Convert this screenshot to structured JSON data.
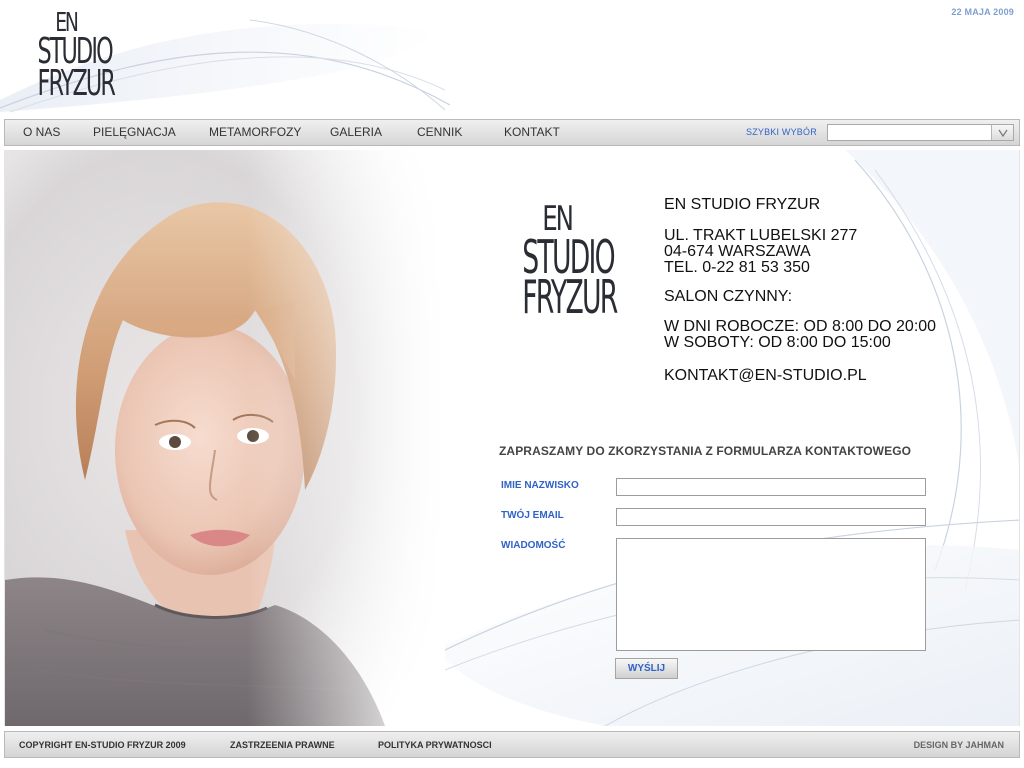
{
  "header": {
    "logo": {
      "line1": "EN",
      "line2": "STUDIO",
      "line3": "FRYZUR"
    },
    "date": "22 MAJA 2009"
  },
  "nav": {
    "items": [
      {
        "label": "O NAS"
      },
      {
        "label": "PIELĘGNACJA"
      },
      {
        "label": "METAMORFOZY"
      },
      {
        "label": "GALERIA"
      },
      {
        "label": "CENNIK"
      },
      {
        "label": "KONTAKT"
      }
    ],
    "quick_select": {
      "label": "SZYBKI WYBÓR",
      "value": "",
      "arrow_icon": "chevron-down-icon"
    }
  },
  "contact": {
    "logo": {
      "line1": "EN",
      "line2": "STUDIO",
      "line3": "FRYZUR"
    },
    "salon_name": "EN STUDIO FRYZUR",
    "address_line1": "UL. TRAKT LUBELSKI 277",
    "address_line2": "04-674 WARSZAWA",
    "phone": "TEL. 0-22 81 53 350",
    "hours_heading": "SALON CZYNNY:",
    "hours_weekdays": "W DNI ROBOCZE: OD 8:00 DO 20:00",
    "hours_saturday": "W SOBOTY: OD 8:00 DO 15:00",
    "email": "KONTAKT@EN-STUDIO.PL"
  },
  "form": {
    "title": "ZAPRASZAMY DO ZKORZYSTANIA Z FORMULARZA KONTAKTOWEGO",
    "name_label": "IMIE NAZWISKO",
    "name_value": "",
    "email_label": "TWÓJ EMAIL",
    "email_value": "",
    "message_label": "WIADOMOŚĆ",
    "message_value": "",
    "submit_label": "WYŚLIJ"
  },
  "footer": {
    "copyright": "COPYRIGHT EN-STUDIO FRYZUR 2009",
    "legal": "ZASTRZEENIA PRAWNE",
    "privacy": "POLITYKA PRYWATNOSCI",
    "design": "DESIGN BY JAHMAN"
  },
  "colors": {
    "accent_blue": "#3063c7",
    "date_blue": "#7f9fd1",
    "bar_grey": "#d5d5d5"
  }
}
